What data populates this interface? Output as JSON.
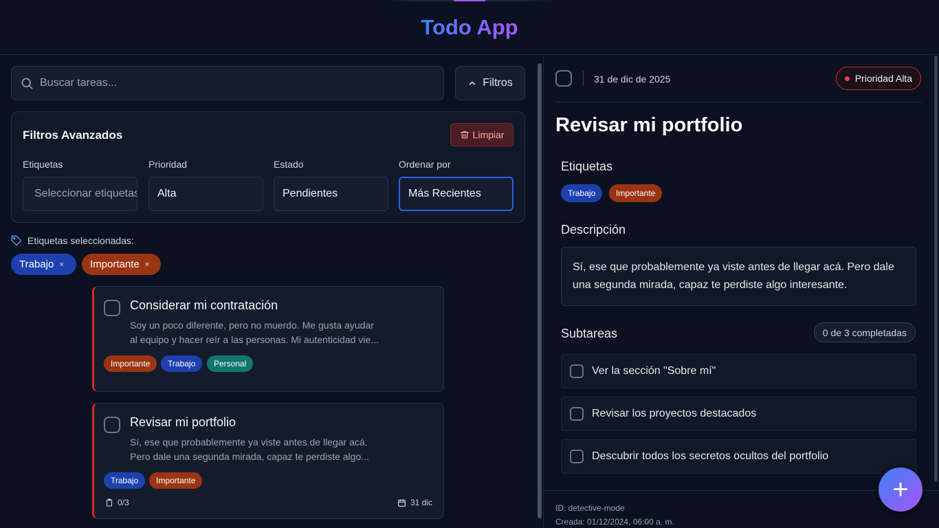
{
  "app": {
    "title": "Todo App"
  },
  "colors": {
    "work": "#1e40af",
    "important": "#9a3412",
    "personal": "#0f766e",
    "priority_high": "#dc2626",
    "accent_start": "#3b82f6",
    "accent_end": "#a855f7"
  },
  "search": {
    "placeholder": "Buscar tareas...",
    "icon": "search-icon"
  },
  "filters_button": {
    "label": "Filtros",
    "icon": "chevron-up-icon"
  },
  "advanced": {
    "title": "Filtros Avanzados",
    "clear_label": "Limpiar",
    "fields": [
      {
        "label": "Etiquetas",
        "value": "Seleccionar etiquetas..."
      },
      {
        "label": "Prioridad",
        "value": "Alta"
      },
      {
        "label": "Estado",
        "value": "Pendientes"
      },
      {
        "label": "Ordenar por",
        "value": "Más Recientes"
      }
    ]
  },
  "selected_tags": {
    "label": "Etiquetas seleccionadas:",
    "chips": [
      "Trabajo",
      "Importante"
    ],
    "remove": "×"
  },
  "tasks": [
    {
      "title": "Considerar mi contratación",
      "desc_line1": "Soy un poco diferente, pero no muerdo. Me gusta ayudar",
      "desc_line2": "al equipo y hacer reír a las personas. Mi autenticidad vie...",
      "tags": [
        "Importante",
        "Trabajo",
        "Personal"
      ]
    },
    {
      "title": "Revisar mi portfolio",
      "desc_line1": "Sí, ese que probablemente ya viste antes de llegar acá.",
      "desc_line2": "Pero dale una segunda mirada, capaz te perdiste algo...",
      "tags": [
        "Trabajo",
        "Importante"
      ],
      "subtasks": "0/3",
      "due": "31 dic"
    }
  ],
  "detail": {
    "date": "31 de dic de 2025",
    "priority": "Prioridad Alta",
    "title": "Revisar mi portfolio",
    "tags_label": "Etiquetas",
    "tags": [
      "Trabajo",
      "Importante"
    ],
    "description_label": "Descripción",
    "description": "Sí, ese que probablemente ya viste antes de llegar acá. Pero dale una segunda mirada, capaz te perdiste algo interesante.",
    "subtasks_label": "Subtareas",
    "subtasks_count": "0 de 3 completadas",
    "subtasks": [
      "Ver la sección \"Sobre mí\"",
      "Revisar los proyectos destacados",
      "Descubrir todos los secretos ocultos del portfolio"
    ],
    "id": "ID: detective-mode",
    "created": "Creada: 01/12/2024, 06:00 a. m."
  },
  "fab": {
    "label": "+"
  }
}
